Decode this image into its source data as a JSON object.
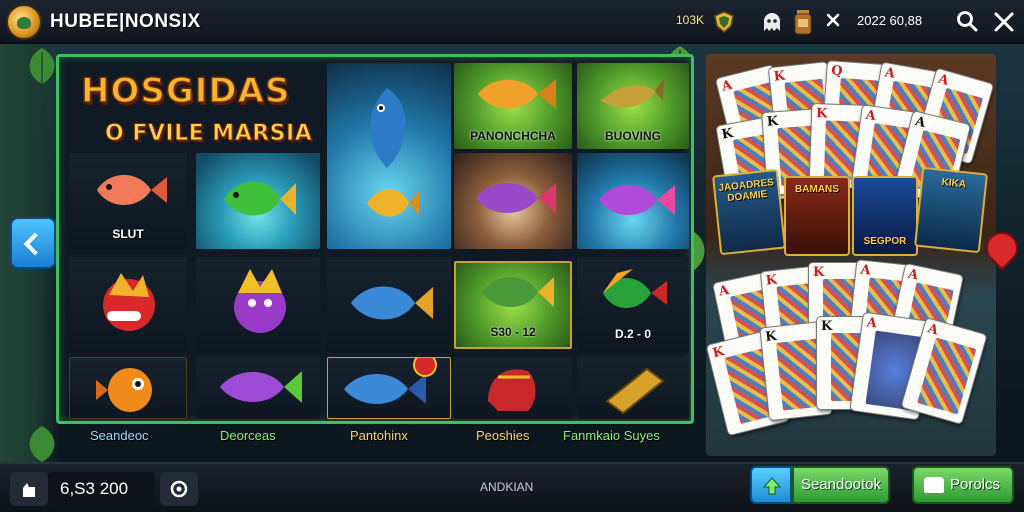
{
  "header": {
    "title": "HUBEE|NONSIX",
    "coins": "103K",
    "balance": "2022 60,88"
  },
  "banner": {
    "title": "HOSGIDAS",
    "subtitle": "O FVILE MARSIA"
  },
  "tiles": {
    "t1_label": "SLUT",
    "t2_label": "PANONCHCHA",
    "t3_label": "BUOVING",
    "t4_label": "S30 - 12",
    "t5_label": "D.2 - 0"
  },
  "categories": [
    "Seandeoc",
    "Deorceas",
    "Pantohinx",
    "Peoshies",
    "Fanmkaio Suyes"
  ],
  "category_colors": [
    "#9ad9ff",
    "#8bf07a",
    "#ffd36a",
    "#ffd36a",
    "#8bf07a"
  ],
  "card_games": [
    "JAOADRES DOAMIE",
    "BAMANS",
    "SEGPOR",
    "KIKA"
  ],
  "bottom": {
    "balance": "6,S3 200",
    "center_text": "ANDKIAN",
    "primary_button": "Seandootok",
    "secondary_button": "Porolcs"
  }
}
